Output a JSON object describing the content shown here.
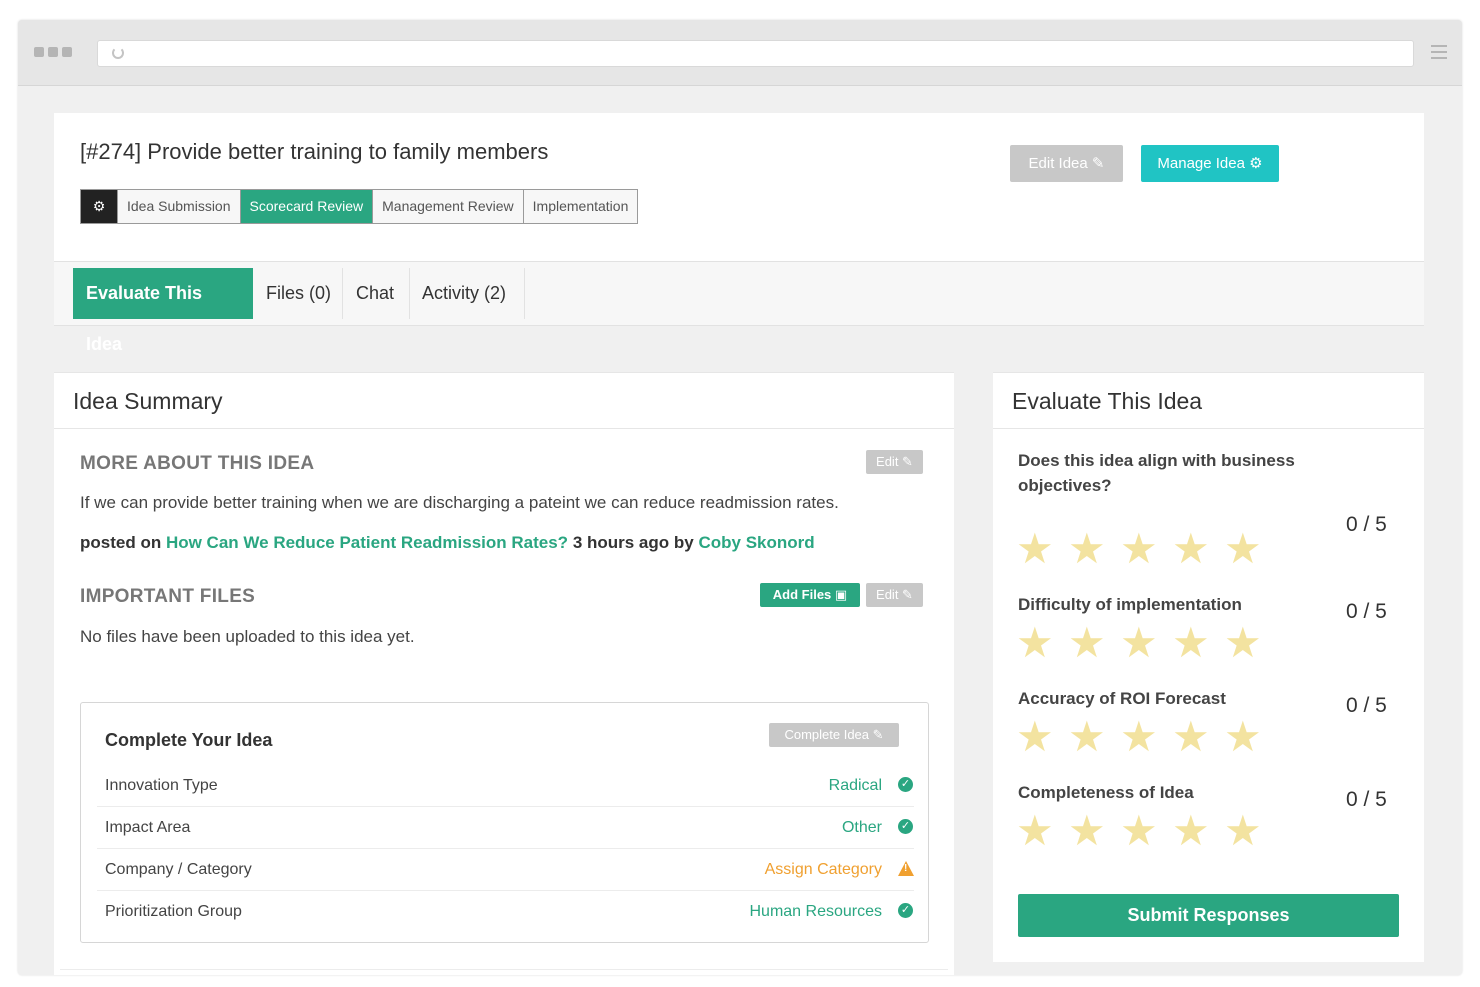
{
  "idea": {
    "title": "[#274] Provide better training to family members",
    "stages": [
      "Idea Submission",
      "Scorecard Review",
      "Management Review",
      "Implementation"
    ],
    "active_stage": "Scorecard Review",
    "edit_label": "Edit Idea",
    "manage_label": "Manage Idea"
  },
  "tabs": [
    {
      "label": "Evaluate This Idea",
      "active": true
    },
    {
      "label": "Files (0)",
      "active": false
    },
    {
      "label": "Chat",
      "active": false
    },
    {
      "label": "Activity (2)",
      "active": false
    }
  ],
  "summary": {
    "title": "Idea Summary",
    "more_heading": "MORE ABOUT THIS IDEA",
    "edit_label": "Edit",
    "description": "If we can provide better training when we are discharging a pateint we can reduce readmission rates.",
    "posted_prefix": "posted on",
    "posted_challenge": "How Can We Reduce Patient Readmission Rates?",
    "posted_time": "3 hours ago by",
    "posted_author": "Coby Skonord",
    "files_heading": "IMPORTANT FILES",
    "add_files_label": "Add Files",
    "no_files_text": "No files have been uploaded to this idea yet."
  },
  "complete": {
    "title": "Complete Your Idea",
    "button_label": "Complete Idea",
    "rows": [
      {
        "label": "Innovation Type",
        "value": "Radical",
        "status": "ok"
      },
      {
        "label": "Impact Area",
        "value": "Other",
        "status": "ok"
      },
      {
        "label": "Company / Category",
        "value": "Assign Category",
        "status": "warn"
      },
      {
        "label": "Prioritization Group",
        "value": "Human Resources",
        "status": "ok"
      }
    ]
  },
  "evaluate": {
    "title": "Evaluate This Idea",
    "questions": [
      {
        "text": "Does this idea align with business objectives?",
        "score": "0 / 5",
        "rating": 0,
        "max": 5
      },
      {
        "text": "Difficulty of implementation",
        "score": "0 / 5",
        "rating": 0,
        "max": 5
      },
      {
        "text": "Accuracy of ROI Forecast",
        "score": "0 / 5",
        "rating": 0,
        "max": 5
      },
      {
        "text": "Completeness of Idea",
        "score": "0 / 5",
        "rating": 0,
        "max": 5
      }
    ],
    "submit_label": "Submit Responses"
  },
  "colors": {
    "accent": "#2aa681",
    "manage": "#20c4c4",
    "warn": "#f0a030",
    "star_empty": "#f3e3a0"
  },
  "icons": {
    "gear": "gear-icon",
    "pencil": "pencil-icon",
    "check": "check-circle-icon",
    "warning": "warning-icon",
    "star": "star-icon"
  }
}
